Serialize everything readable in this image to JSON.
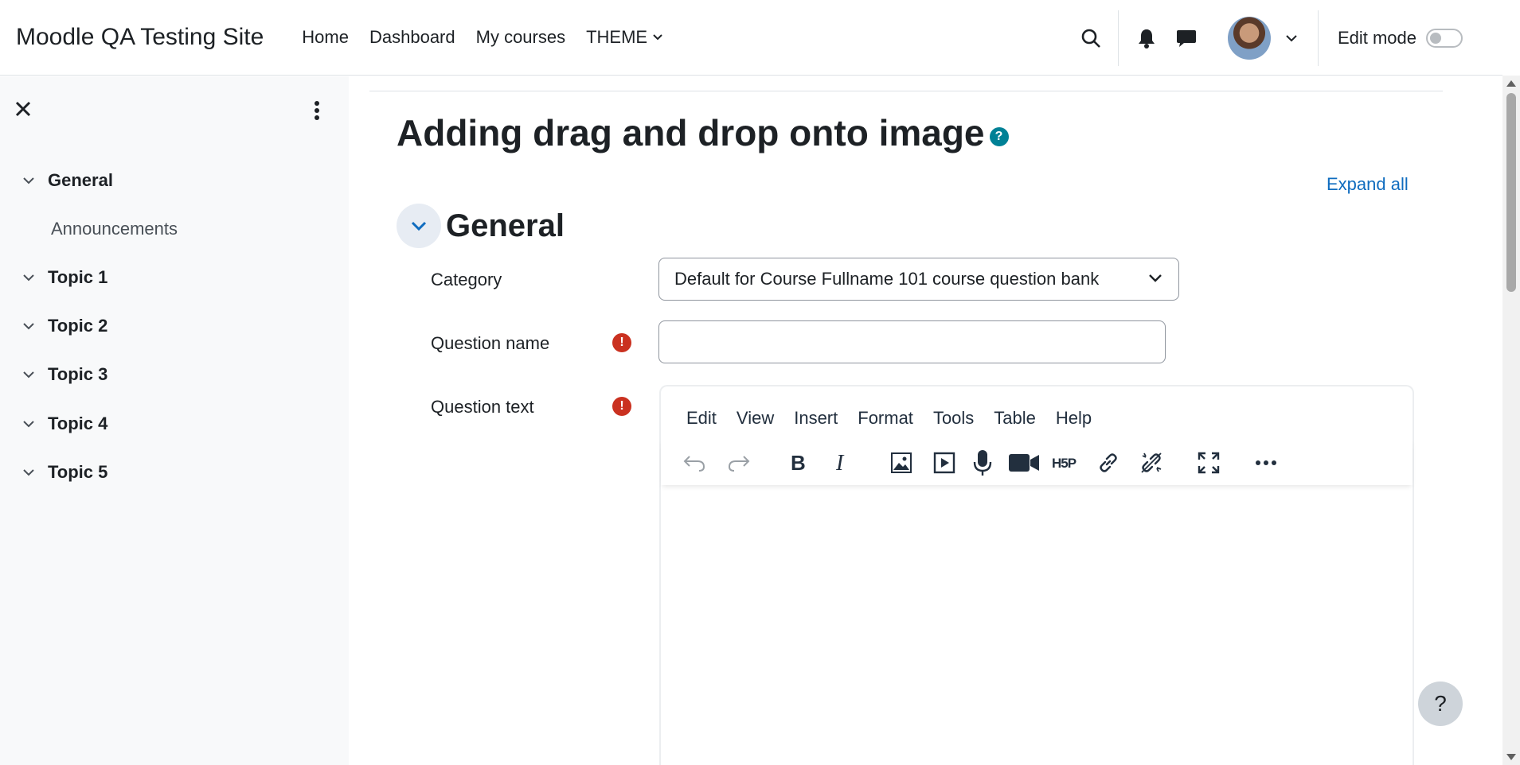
{
  "header": {
    "site_name": "Moodle QA Testing Site",
    "nav": [
      {
        "label": "Home"
      },
      {
        "label": "Dashboard"
      },
      {
        "label": "My courses"
      },
      {
        "label": "THEME"
      }
    ],
    "edit_mode_label": "Edit mode",
    "edit_mode_on": false,
    "icons": [
      "search-icon",
      "bell-icon",
      "chat-icon",
      "avatar",
      "chevron-down-icon"
    ]
  },
  "drawer": {
    "items": [
      {
        "label": "General"
      },
      {
        "label": "Announcements"
      },
      {
        "label": "Topic 1"
      },
      {
        "label": "Topic 2"
      },
      {
        "label": "Topic 3"
      },
      {
        "label": "Topic 4"
      },
      {
        "label": "Topic 5"
      }
    ]
  },
  "main": {
    "title": "Adding drag and drop onto image",
    "help_symbol": "?",
    "expand_all": "Expand all",
    "section_title": "General",
    "fields": {
      "category_label": "Category",
      "category_value": "Default for Course Fullname 101 course question bank",
      "question_name_label": "Question name",
      "question_name_value": "",
      "question_text_label": "Question text",
      "required_symbol": "!"
    },
    "editor": {
      "menu": [
        "Edit",
        "View",
        "Insert",
        "Format",
        "Tools",
        "Table",
        "Help"
      ],
      "toolbar": [
        "undo-icon",
        "redo-icon",
        "bold-icon",
        "italic-icon",
        "image-icon",
        "media-icon",
        "microphone-icon",
        "video-icon",
        "h5p-icon",
        "link-icon",
        "unlink-icon",
        "fullscreen-icon",
        "more-icon"
      ]
    }
  },
  "float_help_label": "?",
  "colors": {
    "link": "#0f6cbf",
    "required": "#ca3120",
    "help": "#008196",
    "drawer_bg": "#f8f9fa"
  }
}
